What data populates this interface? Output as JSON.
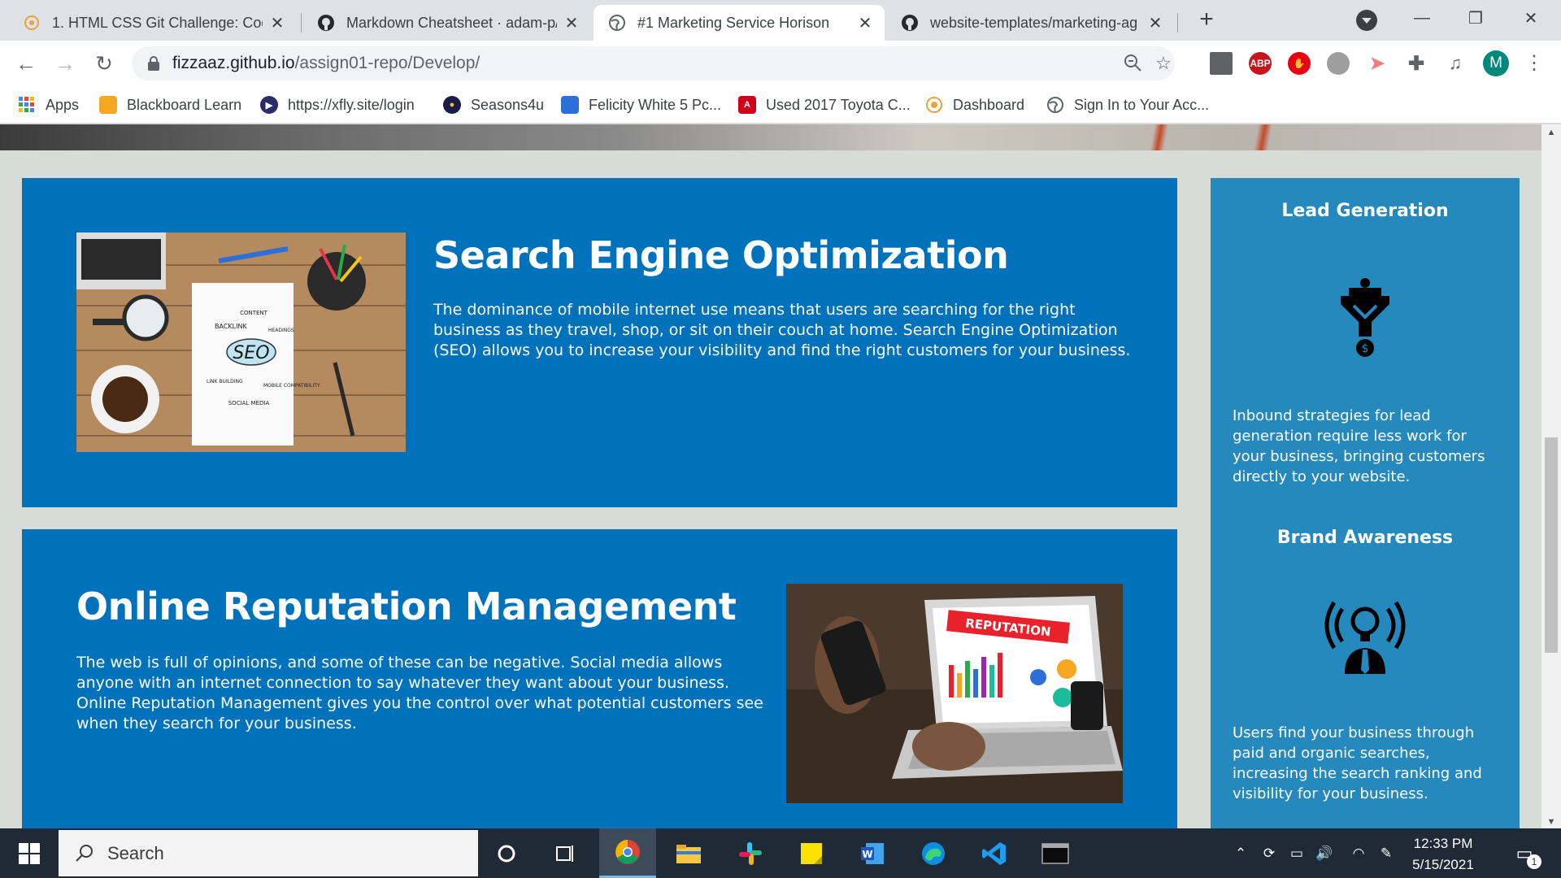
{
  "browser": {
    "tabs": [
      {
        "title": "1. HTML CSS Git Challenge: Code",
        "icon": "course-icon",
        "active": false
      },
      {
        "title": "Markdown Cheatsheet · adam-p/",
        "icon": "github-icon",
        "active": false
      },
      {
        "title": "#1 Marketing Service Horison",
        "icon": "globe-icon",
        "active": true
      },
      {
        "title": "website-templates/marketing-ag",
        "icon": "github-icon",
        "active": false
      }
    ],
    "new_tab": "+",
    "url_host": "fizzaaz.github.io",
    "url_path": "/assign01-repo/Develop/",
    "profile_initial": "M",
    "extensions": [
      "ABP",
      "Ad block",
      "record",
      "share",
      "puzzle",
      "media"
    ]
  },
  "bookmarks": [
    {
      "label": "Apps",
      "icon": "apps-grid-icon",
      "color": "#4285f4"
    },
    {
      "label": "Blackboard Learn",
      "icon": "blackboard-icon",
      "color": "#f5a623"
    },
    {
      "label": "https://xfly.site/login",
      "icon": "play-icon",
      "color": "#2b2a6b"
    },
    {
      "label": "Seasons4u",
      "icon": "seasons-icon",
      "color": "#1c1c4a"
    },
    {
      "label": "Felicity White 5 Pc...",
      "icon": "felicity-icon",
      "color": "#2d6fd8"
    },
    {
      "label": "Used 2017 Toyota C...",
      "icon": "autotrader-icon",
      "color": "#d0021b"
    },
    {
      "label": "Dashboard",
      "icon": "dashboard-icon",
      "color": "#e8a33c"
    },
    {
      "label": "Sign In to Your Acc...",
      "icon": "globe-icon",
      "color": "#5f6368"
    }
  ],
  "page": {
    "seo": {
      "title": "Search Engine Optimization",
      "body": "The dominance of mobile internet use means that users are searching for the right business as they travel, shop, or sit on their couch at home. Search Engine Optimization (SEO) allows you to increase your visibility and find the right customers for your business.",
      "image_words": [
        "CONTENT",
        "BACKLINK",
        "HEADINGS",
        "SEO",
        "LINK BUILDING",
        "MOBILE COMPATIBILITY",
        "SOCIAL MEDIA"
      ]
    },
    "orm": {
      "title": "Online Reputation Management",
      "body": "The web is full of opinions, and some of these can be negative. Social media allows anyone with an internet connection to say whatever they want about your business. Online Reputation Management gives you the control over what potential customers see when they search for your business.",
      "image_word": "REPUTATION"
    },
    "sidebar": [
      {
        "title": "Lead Generation",
        "icon": "lead-funnel-icon",
        "body": "Inbound strategies for lead generation require less work for your business, bringing customers directly to your website."
      },
      {
        "title": "Brand Awareness",
        "icon": "brand-broadcast-icon",
        "body": "Users find your business through paid and organic searches, increasing the search ranking and visibility for your business."
      }
    ]
  },
  "taskbar": {
    "search_placeholder": "Search",
    "apps": [
      "cortana-icon",
      "task-view-icon",
      "chrome-icon",
      "file-explorer-icon",
      "slack-icon",
      "sticky-notes-icon",
      "word-icon",
      "edge-icon",
      "vscode-icon",
      "terminal-icon"
    ],
    "time": "12:33 PM",
    "date": "5/15/2021",
    "notification_count": "1"
  },
  "colors": {
    "card_blue": "#0072bb",
    "sidebar_blue": "#2589bd",
    "page_bg": "#d9dcd6"
  }
}
